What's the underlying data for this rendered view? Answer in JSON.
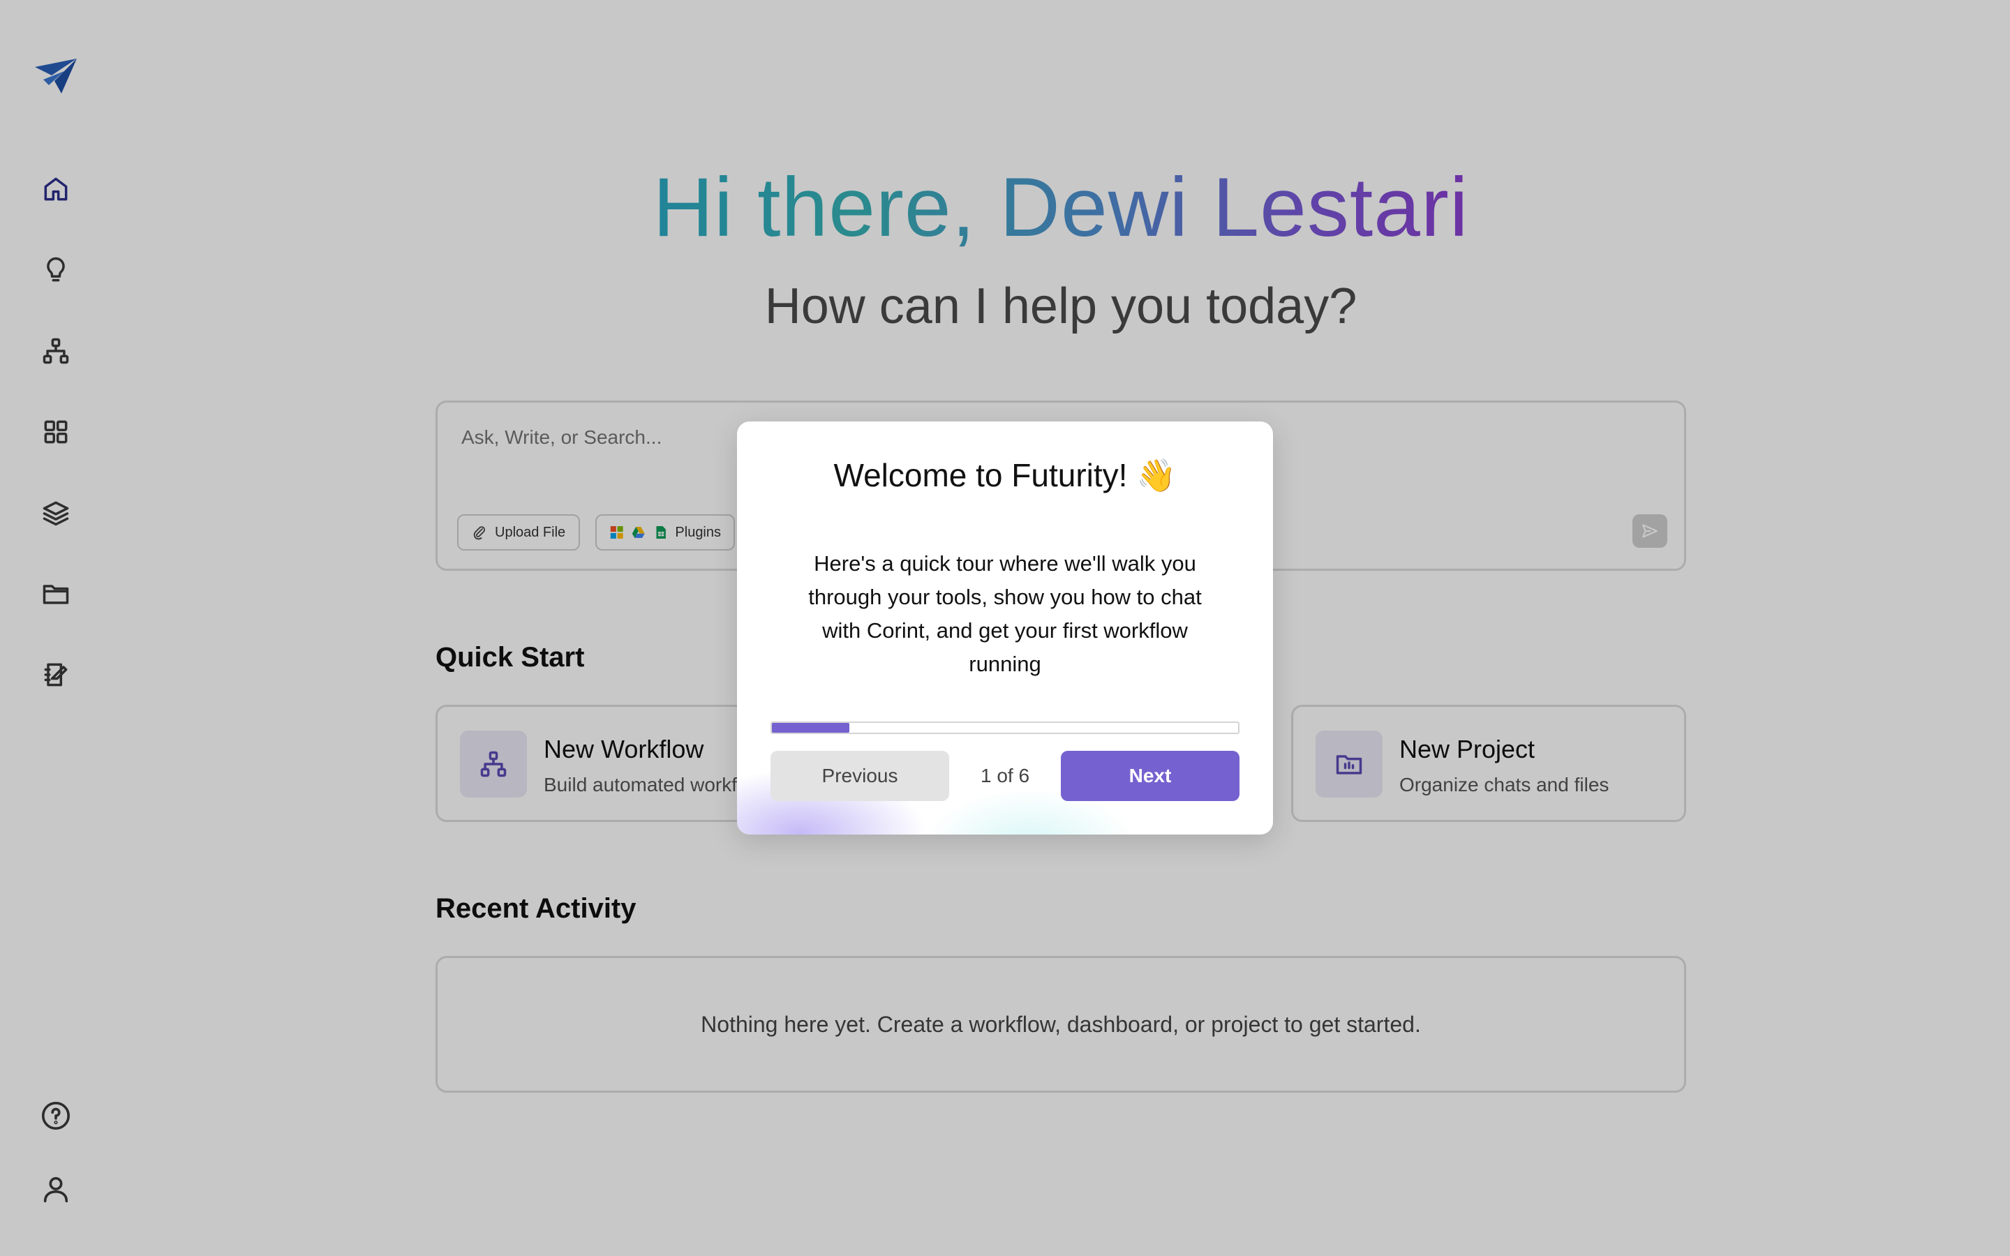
{
  "sidebar": {
    "logo": "paper-plane-logo",
    "items": [
      {
        "name": "home",
        "icon": "home-icon",
        "active": true
      },
      {
        "name": "ideas",
        "icon": "lightbulb-icon"
      },
      {
        "name": "workflows",
        "icon": "hierarchy-icon"
      },
      {
        "name": "dashboards",
        "icon": "grid-icon"
      },
      {
        "name": "layers",
        "icon": "layers-icon"
      },
      {
        "name": "projects",
        "icon": "folder-icon"
      },
      {
        "name": "notebook",
        "icon": "notebook-icon"
      }
    ],
    "bottom": [
      {
        "name": "help",
        "icon": "help-circle-icon"
      },
      {
        "name": "profile",
        "icon": "user-icon"
      }
    ]
  },
  "hero": {
    "greeting": "Hi there, Dewi Lestari",
    "subtitle": "How can I help you today?"
  },
  "composer": {
    "placeholder": "Ask, Write, or Search...",
    "upload_label": "Upload File",
    "plugins_label": "Plugins"
  },
  "quick_start": {
    "title": "Quick Start",
    "cards": [
      {
        "title": "New Workflow",
        "description": "Build automated workflows"
      },
      {
        "title": "New Project",
        "description": "Organize chats and files"
      }
    ]
  },
  "recent": {
    "title": "Recent Activity",
    "empty_text": "Nothing here yet. Create a workflow, dashboard, or project to get started."
  },
  "tour_modal": {
    "title": "Welcome to Futurity! 👋",
    "body": "Here's a quick tour where we'll walk you through your tools, show you how to chat with Corint, and get your first workflow running",
    "progress_fraction": 0.1667,
    "step_text": "1 of 6",
    "previous_label": "Previous",
    "next_label": "Next"
  },
  "colors": {
    "accent": "#7561cf",
    "overlay": "rgba(0,0,0,0.215)",
    "nav_active": "#2c2f8c"
  }
}
